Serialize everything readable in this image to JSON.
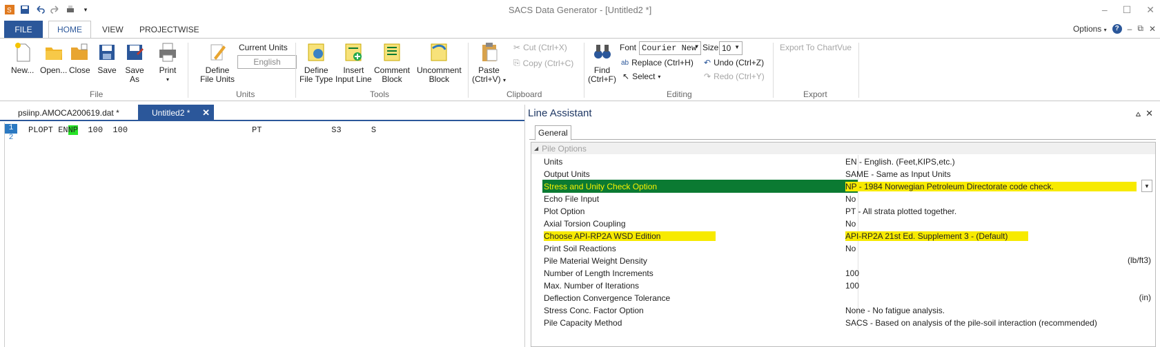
{
  "app": {
    "title": "SACS Data Generator - [Untitled2 *]",
    "min": "–",
    "max": "☐",
    "close": "✕"
  },
  "tabs": {
    "file": "FILE",
    "home": "HOME",
    "view": "VIEW",
    "projectwise": "PROJECTWISE",
    "options": "Options",
    "help": "?"
  },
  "ribbon": {
    "new": "New...",
    "open": "Open...",
    "close": "Close",
    "save": "Save",
    "save_as_1": "Save",
    "save_as_2": "As",
    "print": "Print",
    "file_group": "File",
    "define_units_1": "Define",
    "define_units_2": "File Units",
    "current_units_label": "Current Units",
    "current_units_value": "English",
    "units_group": "Units",
    "define_type_1": "Define",
    "define_type_2": "File Type",
    "insert_line_1": "Insert",
    "insert_line_2": "Input Line",
    "comment_1": "Comment",
    "comment_2": "Block",
    "uncomment_1": "Uncomment",
    "uncomment_2": "Block",
    "tools_group": "Tools",
    "paste_1": "Paste",
    "paste_2": "(Ctrl+V)",
    "cut": "Cut (Ctrl+X)",
    "copy": "Copy (Ctrl+C)",
    "clipboard_group": "Clipboard",
    "find_1": "Find",
    "find_2": "(Ctrl+F)",
    "font_label": "Font",
    "font_value": "Courier New",
    "size_label": "Size",
    "size_value": "10",
    "replace": "Replace (Ctrl+H)",
    "select": "Select",
    "undo": "Undo (Ctrl+Z)",
    "redo": "Redo (Ctrl+Y)",
    "editing_group": "Editing",
    "export_chartvue": "Export To ChartVue",
    "export_group": "Export"
  },
  "doc_tabs": [
    {
      "label": "psiinp.AMOCA200619.dat *"
    },
    {
      "label": "Untitled2 *",
      "close": "✕"
    }
  ],
  "editor": {
    "line_numbers": [
      "1",
      "2"
    ],
    "line1_pre": "PLOPT EN",
    "line1_hl": "NP",
    "line1_post": "  100  100                         PT              S3      S"
  },
  "line_assistant": {
    "title": "Line Assistant",
    "pin": "⩟",
    "close": "✕",
    "tab": "General",
    "group": "Pile Options",
    "rows": [
      {
        "name": "Units",
        "value": "EN - English. (Feet,KIPS,etc.)",
        "unit": ""
      },
      {
        "name": "Output Units",
        "value": "SAME - Same as Input Units",
        "unit": ""
      },
      {
        "name": "Stress and Unity Check Option",
        "value": "NP - 1984 Norwegian Petroleum Directorate code check.",
        "unit": ""
      },
      {
        "name": "Echo File Input",
        "value": "No",
        "unit": ""
      },
      {
        "name": "Plot Option",
        "value": "PT - All strata plotted together.",
        "unit": ""
      },
      {
        "name": "Axial Torsion Coupling",
        "value": "No",
        "unit": ""
      },
      {
        "name": "Choose API-RP2A WSD Edition",
        "value": "API-RP2A 21st Ed. Supplement 3 - (Default)",
        "unit": ""
      },
      {
        "name": "Print Soil Reactions",
        "value": "No",
        "unit": ""
      },
      {
        "name": "Pile Material Weight Density",
        "value": "",
        "unit": "(lb/ft3)"
      },
      {
        "name": "Number of Length Increments",
        "value": "100",
        "unit": ""
      },
      {
        "name": "Max. Number of Iterations",
        "value": "100",
        "unit": ""
      },
      {
        "name": "Deflection Convergence Tolerance",
        "value": "",
        "unit": "(in)"
      },
      {
        "name": "Stress Conc. Factor Option",
        "value": "None - No fatigue analysis.",
        "unit": ""
      },
      {
        "name": "Pile Capacity Method",
        "value": "SACS - Based on analysis of the pile-soil interaction (recommended)",
        "unit": ""
      }
    ]
  },
  "colors": {
    "accent": "#2b579a",
    "selection": "#0b7a32",
    "highlight_yellow": "#f7ea00",
    "code_highlight": "#27e427"
  }
}
